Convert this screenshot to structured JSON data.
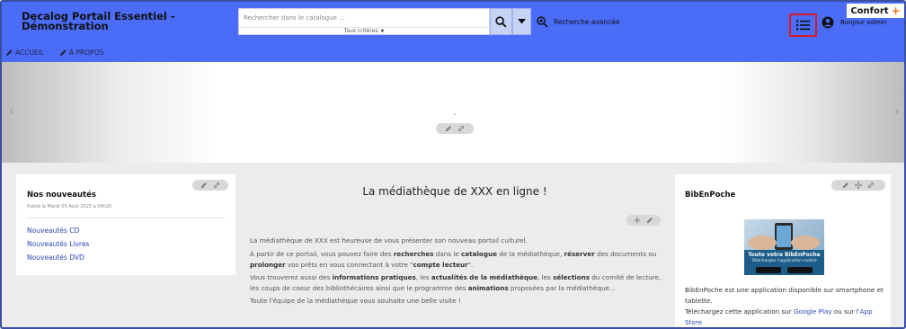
{
  "header": {
    "site_title": "Decalog Portail Essentiel - Démonstration",
    "search_placeholder": "Rechercher dans le catalogue ...",
    "criteria_label": "Tous critères",
    "advanced_search_label": "Recherche avancée",
    "user_label": "Bonjour admin",
    "confort_label": "Confort",
    "confort_plus": "+"
  },
  "nav": {
    "items": [
      {
        "label": "ACCUEIL"
      },
      {
        "label": "A PROPOS"
      }
    ]
  },
  "carousel": {
    "prev_arrow": "‹",
    "next_arrow": "›"
  },
  "left_card": {
    "title": "Nos nouveautés",
    "date": "Publié le Mardi 05 Août 2025 à 09h20",
    "links": [
      {
        "label": "Nouveautés CD"
      },
      {
        "label": "Nouveautés Livres"
      },
      {
        "label": "Nouveautés DVD"
      }
    ]
  },
  "middle": {
    "title": "La médiathèque de XXX en ligne !",
    "p1": "La médiathèque de XXX est heureuse de vous présenter son nouveau portail culturel.",
    "p2_a": "À partir de ce portail, vous pouvez faire des ",
    "p2_b": "recherches",
    "p2_c": " dans le ",
    "p2_d": "catalogue",
    "p2_e": " de la médiathèque, ",
    "p2_f": "réserver",
    "p2_g": " des documents ou ",
    "p2_h": "prolonger",
    "p2_i": " vos prêts en vous connectant à votre \"",
    "p2_j": "compte lecteur",
    "p2_k": "\".",
    "p3_a": "Vous trouverez aussi des ",
    "p3_b": "informations pratiques",
    "p3_c": ", les ",
    "p3_d": "actualités de la médiathèque",
    "p3_e": ", les ",
    "p3_f": "sélections",
    "p3_g": " du comité de lecture, les coups de coeur des bibliothécaires ainsi que le programme des ",
    "p3_h": "animations",
    "p3_i": " proposées par la médiathèque...",
    "p4": "Toute l'équipe de la médiathèque vous souhaite une belle visite !"
  },
  "right_card": {
    "title": "BibEnPoche",
    "promo_line1": "Toute votre BibEnPoche",
    "promo_line2": "Téléchargez l'application mobile",
    "text1": "BibEnPoche est une application disponible sur smartphone et tablette.",
    "text2_a": "Téléchargez cette application sur ",
    "text2_b": "Google Play",
    "text2_c": " ou sur ",
    "text2_d": "l'App Store"
  },
  "colors": {
    "header_bg": "#4a6cf7",
    "link": "#2a47b8",
    "highlight_border": "#d61a2b",
    "confort_plus": "#f07a1a"
  }
}
